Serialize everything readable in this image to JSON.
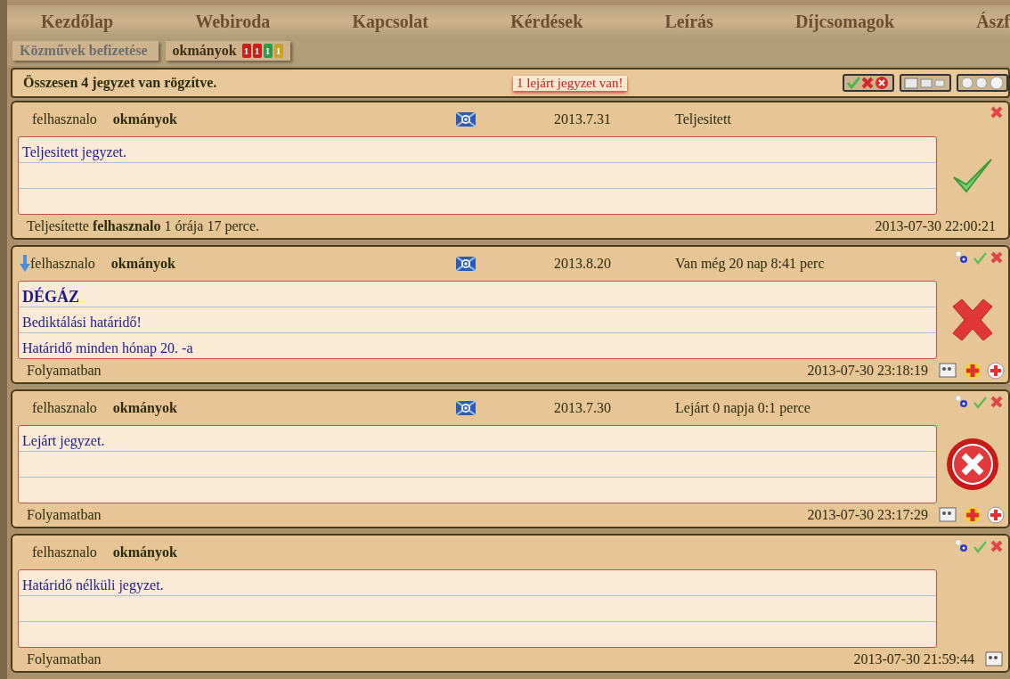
{
  "nav": [
    {
      "label": "Kezdőlap"
    },
    {
      "label": "Webiroda"
    },
    {
      "label": "Kapcsolat"
    },
    {
      "label": "Kérdések"
    },
    {
      "label": "Leírás"
    },
    {
      "label": "Díjcsomagok"
    },
    {
      "label": "Ászf"
    }
  ],
  "subtabs": [
    {
      "label": "Közművek befizetése",
      "selected": false
    },
    {
      "label": "okmányok",
      "selected": true,
      "badges": [
        {
          "text": "1",
          "color": "#c8201c"
        },
        {
          "text": "1",
          "color": "#c8201c"
        },
        {
          "text": "1",
          "color": "#2f9a45"
        },
        {
          "text": "1",
          "color": "#c9a02a"
        }
      ]
    }
  ],
  "summary": "Összesen 4 jegyzet van rögzítve.",
  "alert": "1 lejárt jegyzet van!",
  "notes": [
    {
      "kind": "done",
      "reminder": false,
      "user": "felhasznalo",
      "category": "okmányok",
      "date": "2013.7.31",
      "state_text": "Teljesitett",
      "lines": [
        {
          "text": "Teljesitett jegyzet.",
          "bold": false
        }
      ],
      "footer": "Teljesítette **felhasznalo** 1 órája 17 perce.",
      "timestamp": "2013-07-30 22:00:21"
    },
    {
      "kind": "active",
      "reminder": true,
      "user": "felhasznalo",
      "category": "okmányok",
      "date": "2013.8.20",
      "state_text": "Van még 20 nap 8:41 perc",
      "lines": [
        {
          "text": "DÉGÁZ",
          "bold": true
        },
        {
          "text": "Bediktálási határidő!",
          "bold": false
        },
        {
          "text": "Határidő minden hónap 20. -a",
          "bold": false
        }
      ],
      "footer": "Folyamatban",
      "timestamp": "2013-07-30 23:18:19"
    },
    {
      "kind": "expired",
      "reminder": false,
      "user": "felhasznalo",
      "category": "okmányok",
      "date": "2013.7.30",
      "state_text": "Lejárt 0 napja 0:1 perce",
      "lines": [
        {
          "text": "Lejárt jegyzet.",
          "bold": false
        }
      ],
      "footer": "Folyamatban",
      "timestamp": "2013-07-30 23:17:29"
    },
    {
      "kind": "open",
      "reminder": false,
      "user": "felhasznalo",
      "category": "okmányok",
      "lines": [
        {
          "text": "Határidő nélküli jegyzet.",
          "bold": false
        }
      ],
      "footer": "Folyamatban",
      "timestamp": "2013-07-30 21:59:44"
    }
  ]
}
